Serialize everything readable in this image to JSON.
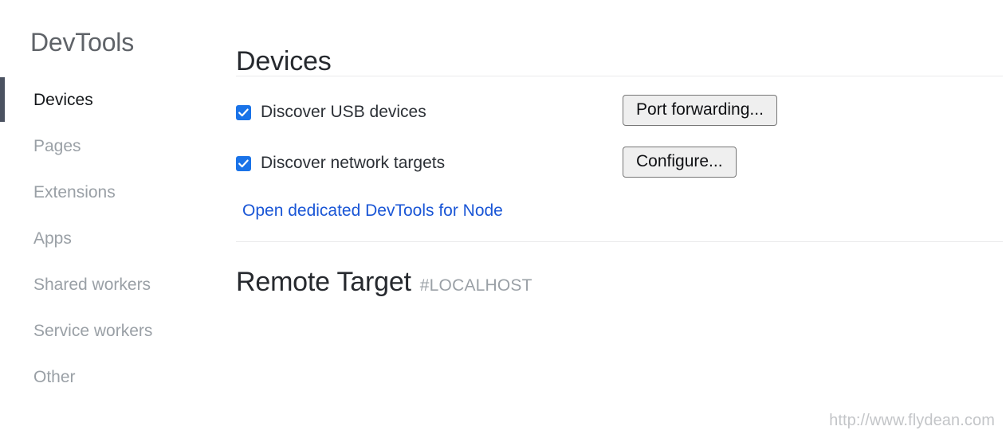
{
  "sidebar": {
    "title": "DevTools",
    "items": [
      {
        "label": "Devices",
        "active": true
      },
      {
        "label": "Pages",
        "active": false
      },
      {
        "label": "Extensions",
        "active": false
      },
      {
        "label": "Apps",
        "active": false
      },
      {
        "label": "Shared workers",
        "active": false
      },
      {
        "label": "Service workers",
        "active": false
      },
      {
        "label": "Other",
        "active": false
      }
    ]
  },
  "main": {
    "page_title": "Devices",
    "checkboxes": [
      {
        "label": "Discover USB devices",
        "checked": true
      },
      {
        "label": "Discover network targets",
        "checked": true
      }
    ],
    "buttons": {
      "port_forwarding": "Port forwarding...",
      "configure": "Configure..."
    },
    "node_link": "Open dedicated DevTools for Node",
    "remote_target": {
      "title": "Remote Target",
      "host": "#LOCALHOST"
    }
  },
  "watermark": "http://www.flydean.com",
  "colors": {
    "accent_checkbox": "#1a73e8",
    "link": "#1a56d6",
    "active_indicator": "#4b5261",
    "nav_inactive": "#9aa0a6",
    "heading": "#26292e",
    "sidebar_title": "#5f6368",
    "divider": "#eaeaec",
    "button_face": "#efefef",
    "button_border": "#767676",
    "watermark": "#c3c5c8"
  }
}
